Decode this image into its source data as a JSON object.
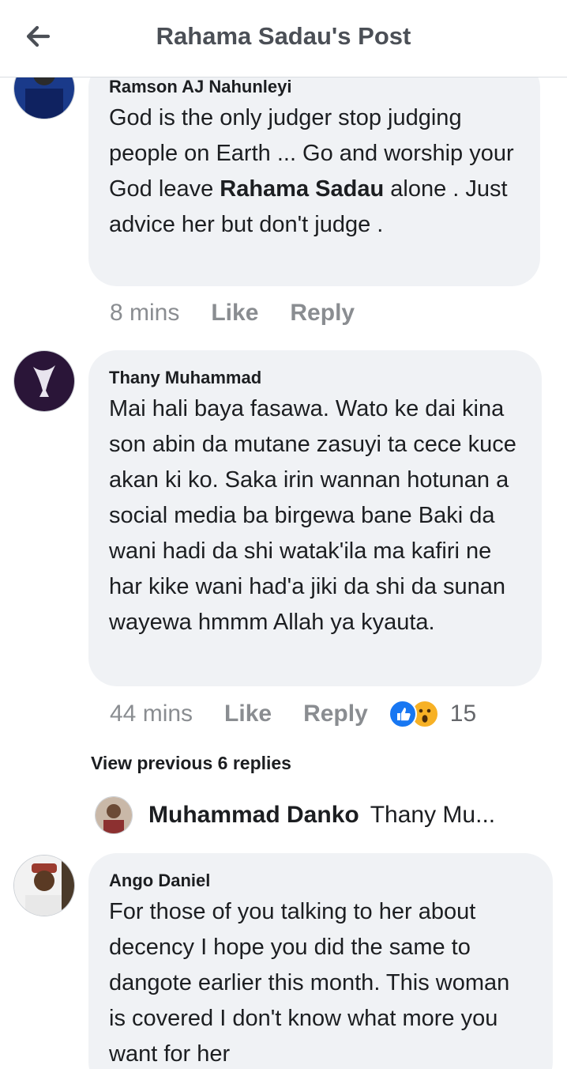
{
  "header": {
    "title": "Rahama Sadau's Post",
    "back_icon": "arrow-left-icon"
  },
  "comments": [
    {
      "author": "Ramson AJ Nahunleyi",
      "text_before": "God is the only judger stop judging people on Earth ... Go and worship your God leave ",
      "text_bold": "Rahama Sadau",
      "text_after": " alone . Just advice her but don't judge .",
      "time": "8 mins",
      "like": "Like",
      "reply": "Reply"
    },
    {
      "author": "Thany Muhammad",
      "text": "Mai hali baya fasawa. Wato ke dai kina son abin da mutane zasuyi ta cece kuce akan ki ko. Saka irin wannan hotunan a social media ba birgewa bane Baki da wani hadi da shi watak'ila ma kafiri ne har kike wani had'a jiki da shi da sunan wayewa hmmm Allah ya kyauta.",
      "time": "44 mins",
      "like": "Like",
      "reply": "Reply",
      "reaction_count": "15",
      "reactions": [
        "like",
        "wow"
      ]
    },
    {
      "author": "Ango Daniel",
      "text": "For those of you talking to her about decency I hope you did the same to dangote earlier this month. This woman is covered I don't know what more you want for her"
    }
  ],
  "view_previous": "View previous 6 replies",
  "reply_preview": {
    "author": "Muhammad Danko",
    "text": "Thany Mu..."
  },
  "colors": {
    "bubble": "#f0f2f5",
    "meta": "#8a8d91",
    "like_blue": "#1877f2",
    "wow_yellow": "#f7b125"
  }
}
